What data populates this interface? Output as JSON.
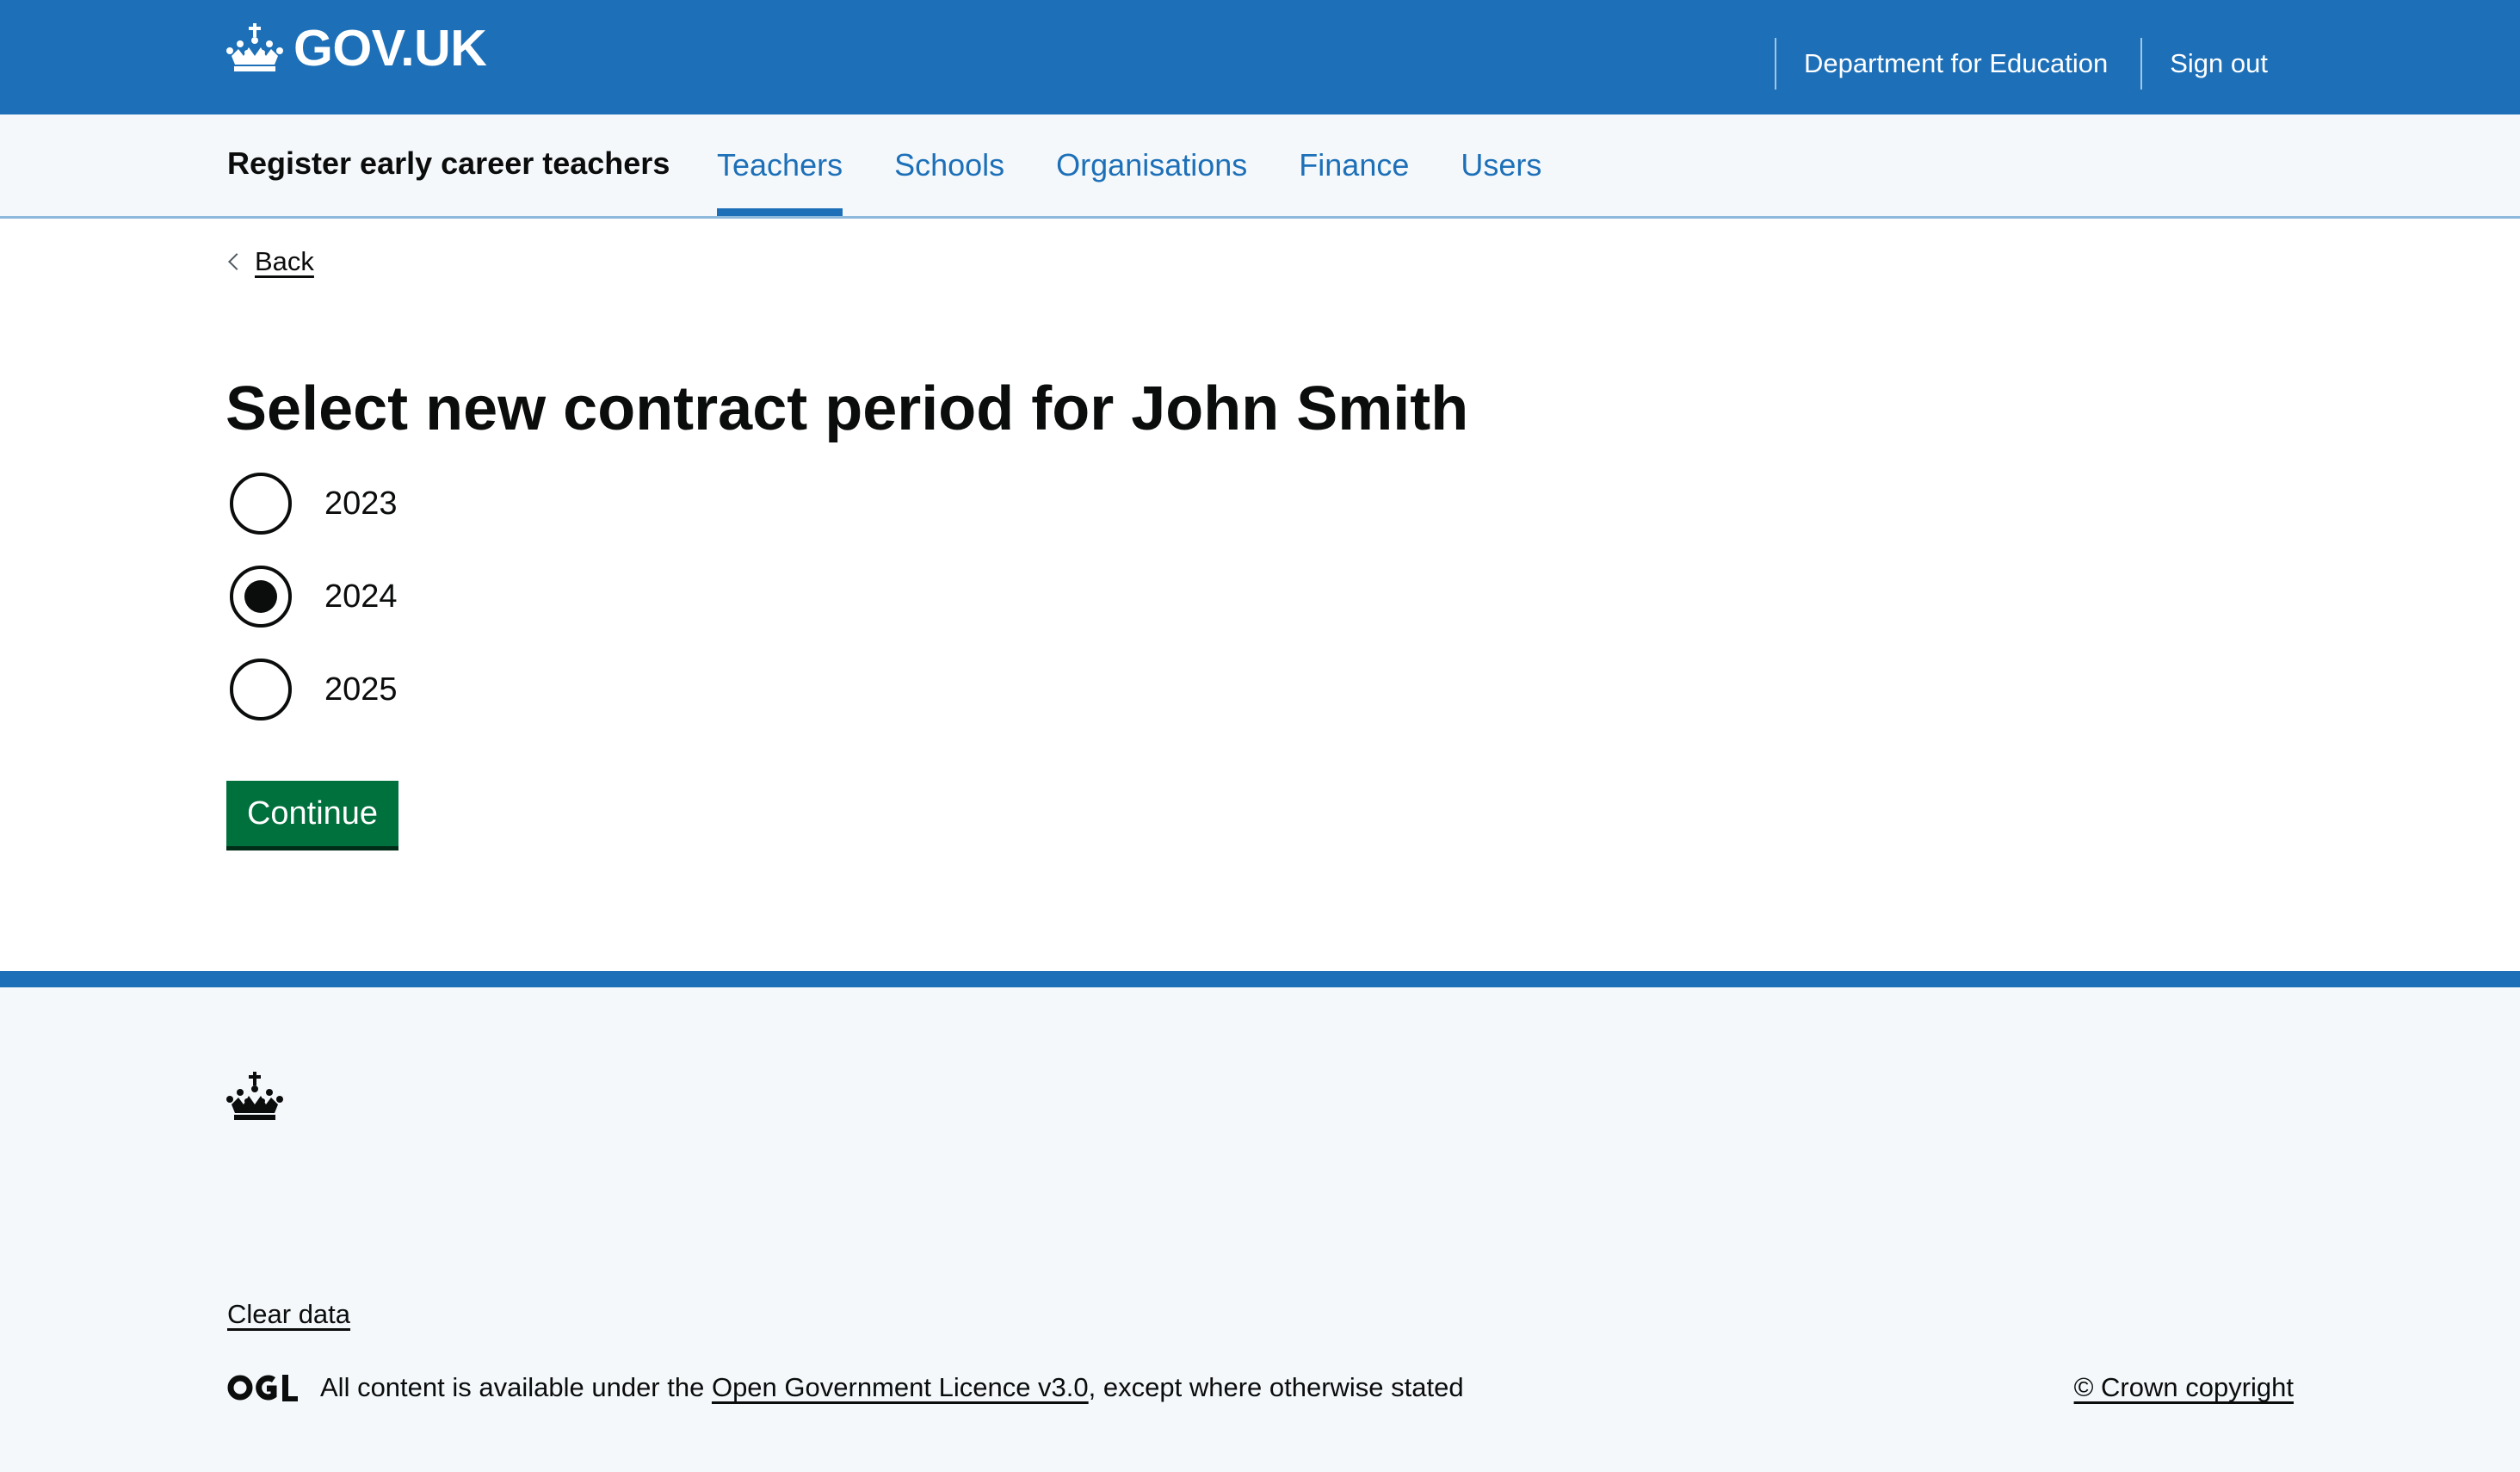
{
  "header": {
    "logo_text": "GOV.UK",
    "links": [
      "Department for Education",
      "Sign out"
    ]
  },
  "service_nav": {
    "service_name": "Register early career teachers",
    "items": [
      {
        "label": "Teachers",
        "active": true
      },
      {
        "label": "Schools",
        "active": false
      },
      {
        "label": "Organisations",
        "active": false
      },
      {
        "label": "Finance",
        "active": false
      },
      {
        "label": "Users",
        "active": false
      }
    ]
  },
  "back_link": "Back",
  "page_title": "Select new contract period for John Smith",
  "radios": [
    {
      "label": "2023",
      "checked": false
    },
    {
      "label": "2024",
      "checked": true
    },
    {
      "label": "2025",
      "checked": false
    }
  ],
  "continue_label": "Continue",
  "footer": {
    "clear_data": "Clear data",
    "licence_prefix": "All content is available under the ",
    "licence_link": "Open Government Licence v3.0",
    "licence_suffix": ", except where otherwise stated",
    "copyright": "© Crown copyright"
  },
  "colors": {
    "brand_blue": "#1d70b8",
    "button_green": "#00703c",
    "nav_background": "#f4f8fb",
    "text": "#0b0c0c"
  },
  "icons": [
    "crown-icon",
    "back-chevron-icon",
    "ogl-logo-icon"
  ]
}
